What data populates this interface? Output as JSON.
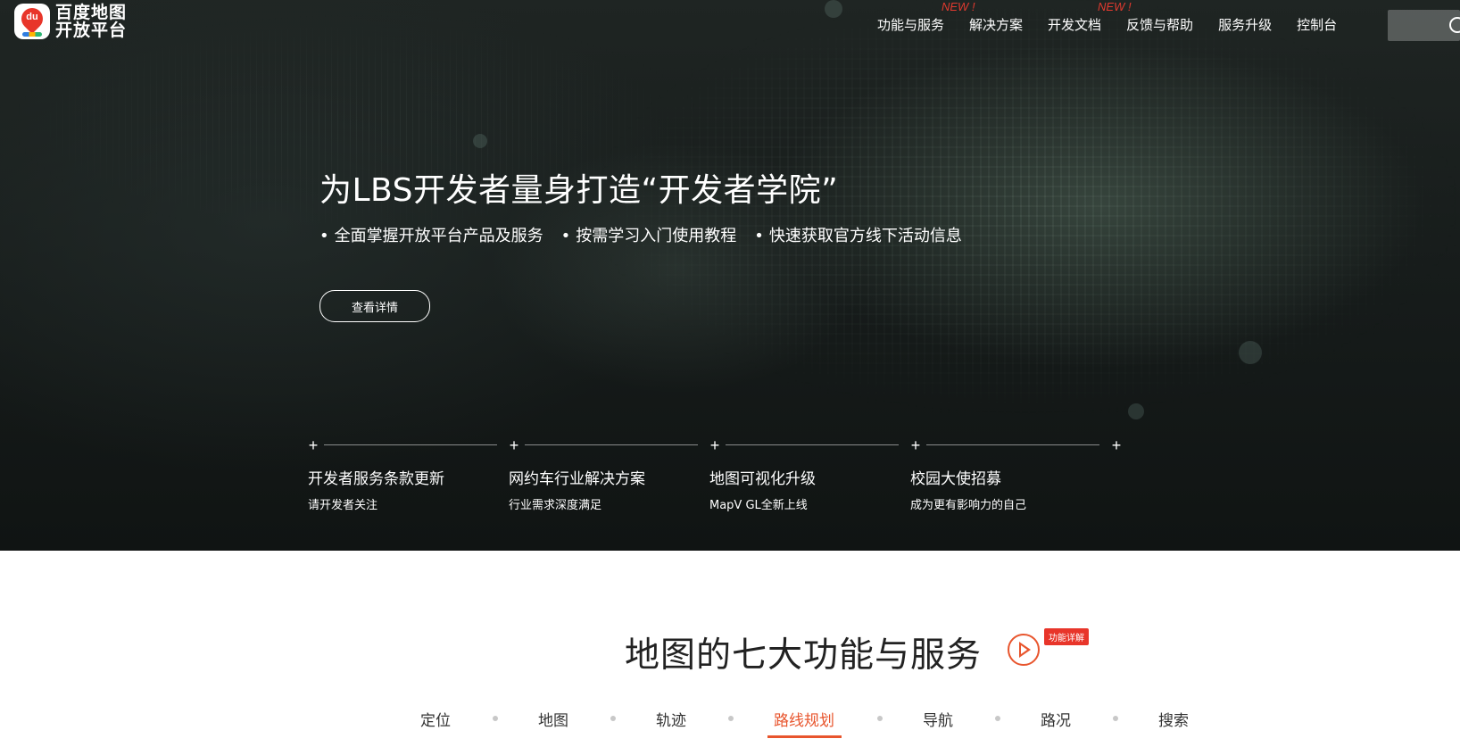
{
  "brand": {
    "logo_badge_text": "du",
    "name_line1": "百度地图",
    "name_line2": "开放平台"
  },
  "nav": {
    "items": [
      {
        "label": "功能与服务",
        "badge": "NEW !"
      },
      {
        "label": "解决方案",
        "badge": ""
      },
      {
        "label": "开发文档",
        "badge": "NEW !"
      },
      {
        "label": "反馈与帮助",
        "badge": ""
      },
      {
        "label": "服务升级",
        "badge": ""
      },
      {
        "label": "控制台",
        "badge": ""
      }
    ]
  },
  "hero": {
    "title": "为LBS开发者量身打造“开发者学院”",
    "bullets": [
      "全面掌握开放平台产品及服务",
      "按需学习入门使用教程",
      "快速获取官方线下活动信息"
    ],
    "button_label": "查看详情"
  },
  "news": [
    {
      "title": "开发者服务条款更新",
      "subtitle": "请开发者关注"
    },
    {
      "title": "网约车行业解决方案",
      "subtitle": "行业需求深度满足"
    },
    {
      "title": "地图可视化升级",
      "subtitle": "MapV GL全新上线"
    },
    {
      "title": "校园大使招募",
      "subtitle": "成为更有影响力的自己"
    }
  ],
  "section": {
    "title": "地图的七大功能与服务",
    "badge": "功能详解",
    "tabs": [
      "定位",
      "地图",
      "轨迹",
      "路线规划",
      "导航",
      "路况",
      "搜索"
    ],
    "active_tab": "路线规划"
  },
  "colors": {
    "accent": "#e8552d",
    "badge_red": "#e8352a",
    "hero_bg": "#1a201e"
  }
}
